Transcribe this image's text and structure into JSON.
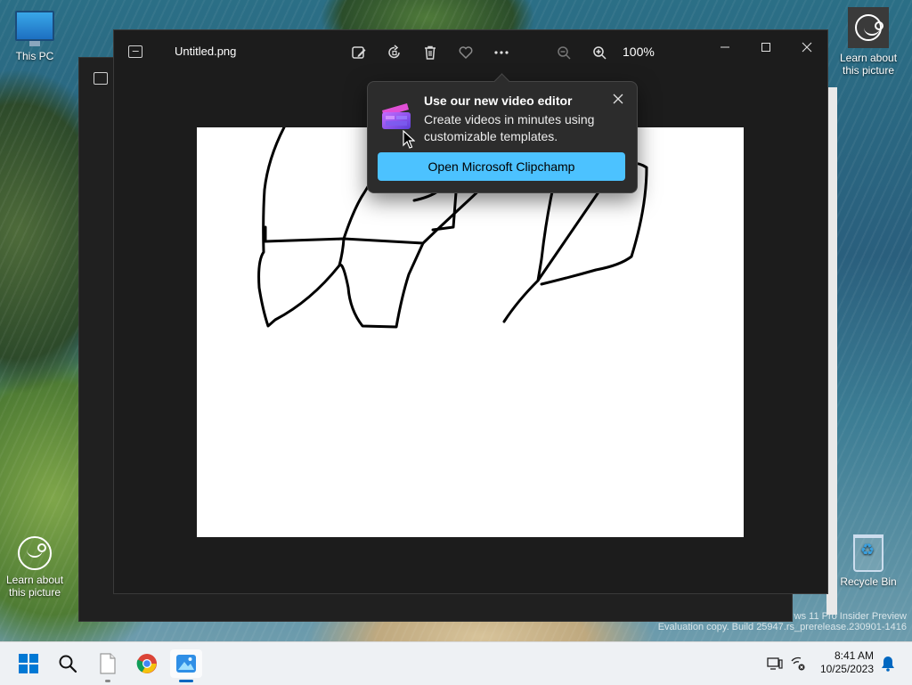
{
  "desktop": {
    "icons": {
      "this_pc": "This PC",
      "learn_top": "Learn about this picture",
      "learn_bottom": "Learn about this picture",
      "recycle_bin": "Recycle Bin"
    },
    "watermark_line1": "ws 11 Pro Insider Preview",
    "watermark_line2": "Evaluation copy. Build 25947.rs_prerelease.230901-1416"
  },
  "photos_window": {
    "filename": "Untitled.png",
    "zoom_level": "100%",
    "toolbar_icons": [
      "edit-image-icon",
      "rotate-icon",
      "delete-icon",
      "favorite-icon",
      "more-icon",
      "zoom-out-icon",
      "zoom-in-icon"
    ],
    "window_controls": [
      "minimize-icon",
      "maximize-icon",
      "close-icon"
    ]
  },
  "popup": {
    "title": "Use our new video editor",
    "body": "Create videos in minutes using customizable templates.",
    "button": "Open Microsoft Clipchamp"
  },
  "taskbar": {
    "time": "8:41 AM",
    "date": "10/25/2023",
    "apps": [
      "start-icon",
      "search-icon",
      "file-icon",
      "chrome-icon",
      "photos-icon"
    ]
  },
  "colors": {
    "accent_button": "#4cc2ff",
    "window_bg": "#1c1c1c",
    "taskbar_bg": "#eef1f4"
  }
}
